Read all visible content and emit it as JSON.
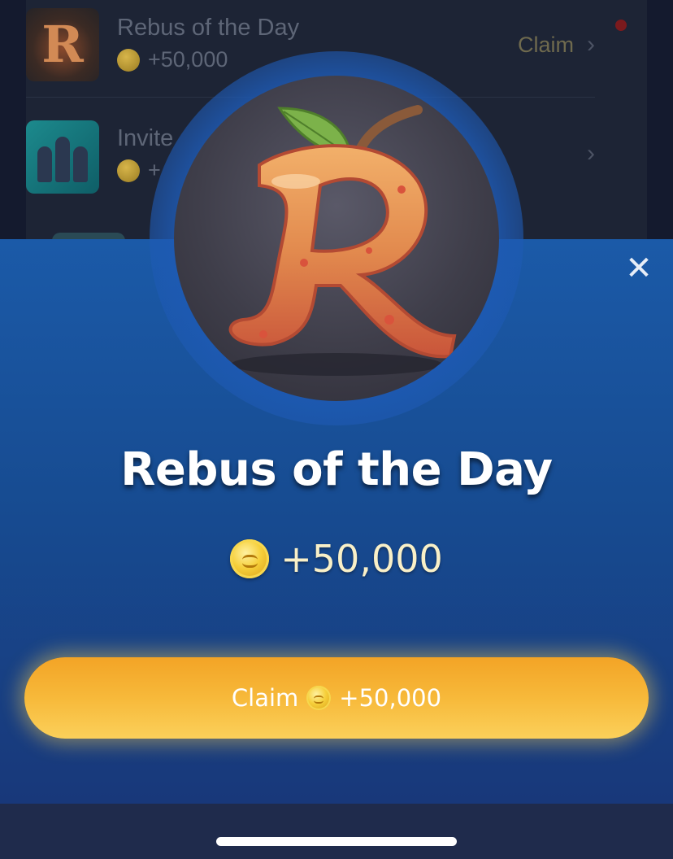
{
  "background_list": {
    "items": [
      {
        "title": "Rebus of the Day",
        "reward": "+50,000",
        "action": "Claim",
        "icon": "rebus-apple-icon",
        "has_notification": true
      },
      {
        "title": "Invite",
        "reward": "+",
        "icon": "invite-people-icon"
      }
    ]
  },
  "modal": {
    "close_icon": "close-icon",
    "hero_icon": "apple-letter-r-icon",
    "title": "Rebus of the Day",
    "reward": "+50,000",
    "claim_button": {
      "label": "Claim",
      "reward": "+50,000"
    }
  },
  "colors": {
    "sheet_top": "#1b5aa8",
    "sheet_bottom": "#18387a",
    "button_top": "#f3a426",
    "button_bottom": "#fbd05a",
    "coin": "#f6cf3a",
    "notification_dot": "#7b1a1d"
  }
}
